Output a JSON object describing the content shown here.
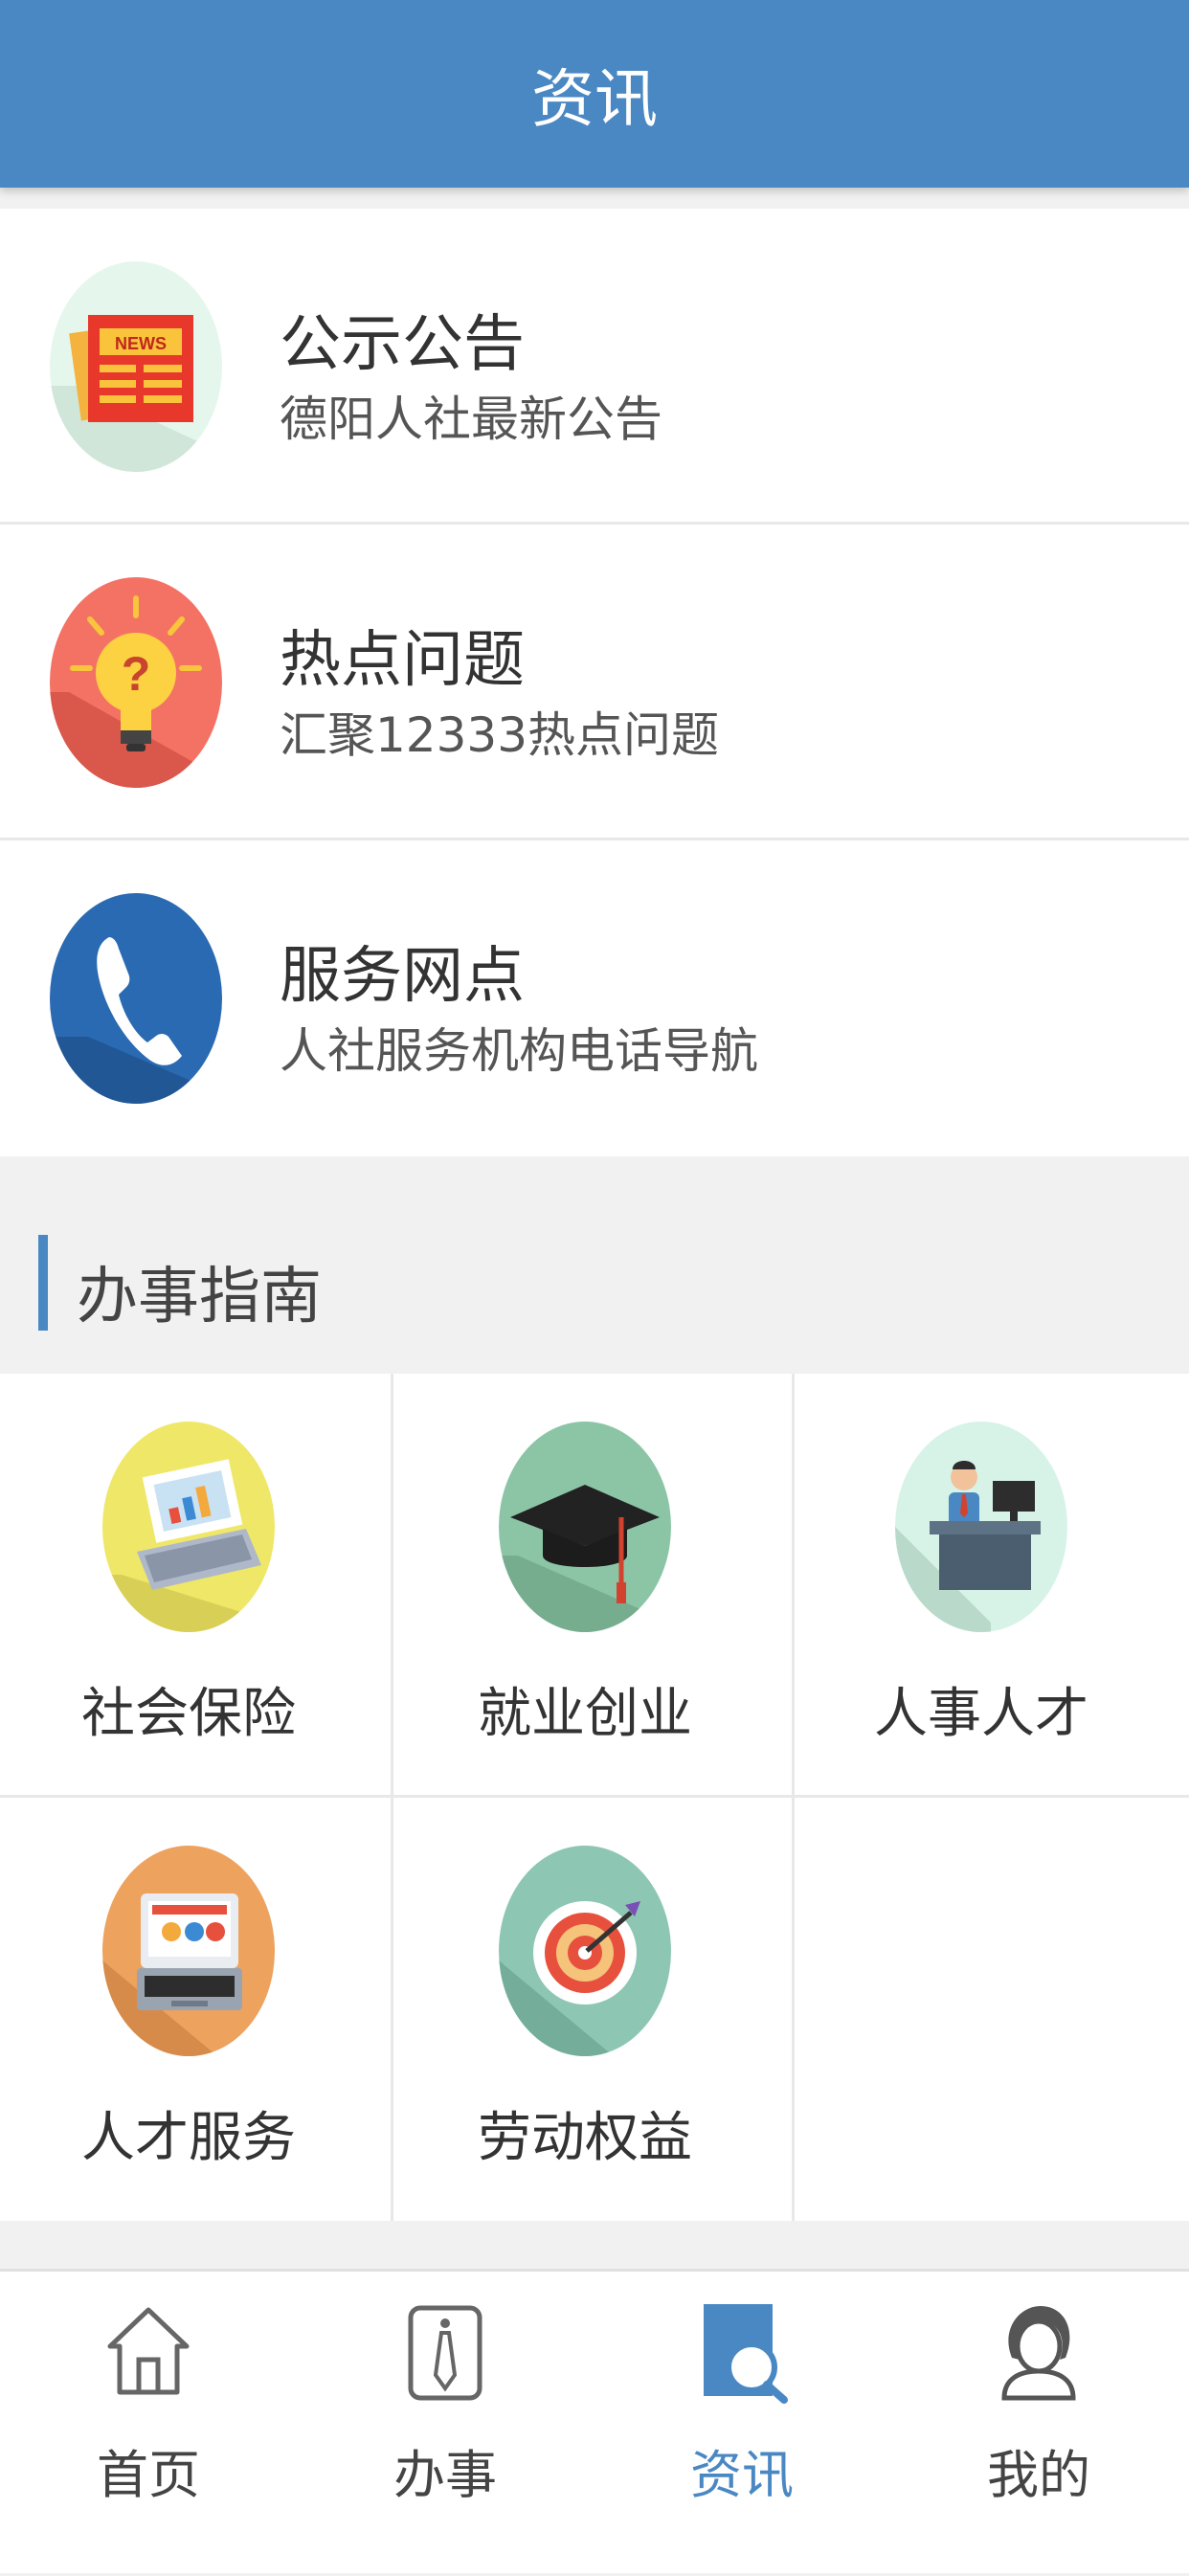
{
  "header": {
    "title": "资讯"
  },
  "info_list": [
    {
      "title": "公示公告",
      "subtitle": "德阳人社最新公告",
      "icon": "news-icon",
      "badge": "NEWS"
    },
    {
      "title": "热点问题",
      "subtitle": "汇聚12333热点问题",
      "icon": "lightbulb-icon"
    },
    {
      "title": "服务网点",
      "subtitle": "人社服务机构电话导航",
      "icon": "phone-icon"
    }
  ],
  "guide": {
    "title": "办事指南",
    "items": [
      {
        "label": "社会保险",
        "icon": "laptop-chart-icon"
      },
      {
        "label": "就业创业",
        "icon": "graduation-cap-icon"
      },
      {
        "label": "人事人才",
        "icon": "office-desk-icon"
      },
      {
        "label": "人才服务",
        "icon": "laptop-icon"
      },
      {
        "label": "劳动权益",
        "icon": "target-icon"
      }
    ]
  },
  "tabbar": {
    "items": [
      {
        "label": "首页",
        "icon": "home-icon",
        "active": false
      },
      {
        "label": "办事",
        "icon": "tie-icon",
        "active": false
      },
      {
        "label": "资讯",
        "icon": "news-search-icon",
        "active": true
      },
      {
        "label": "我的",
        "icon": "user-icon",
        "active": false
      }
    ]
  },
  "colors": {
    "primary": "#4a88c4",
    "background": "#f1f1f1",
    "news_icon_bg": "#e5f7ec",
    "hot_icon_bg": "#f37264",
    "phone_icon_bg": "#2a6ab2",
    "insurance_icon_bg": "#efe768",
    "employment_icon_bg": "#8cc5a6",
    "personnel_icon_bg": "#d7f3e7",
    "talent_icon_bg": "#eda25e",
    "labor_icon_bg": "#8ec6b4"
  }
}
